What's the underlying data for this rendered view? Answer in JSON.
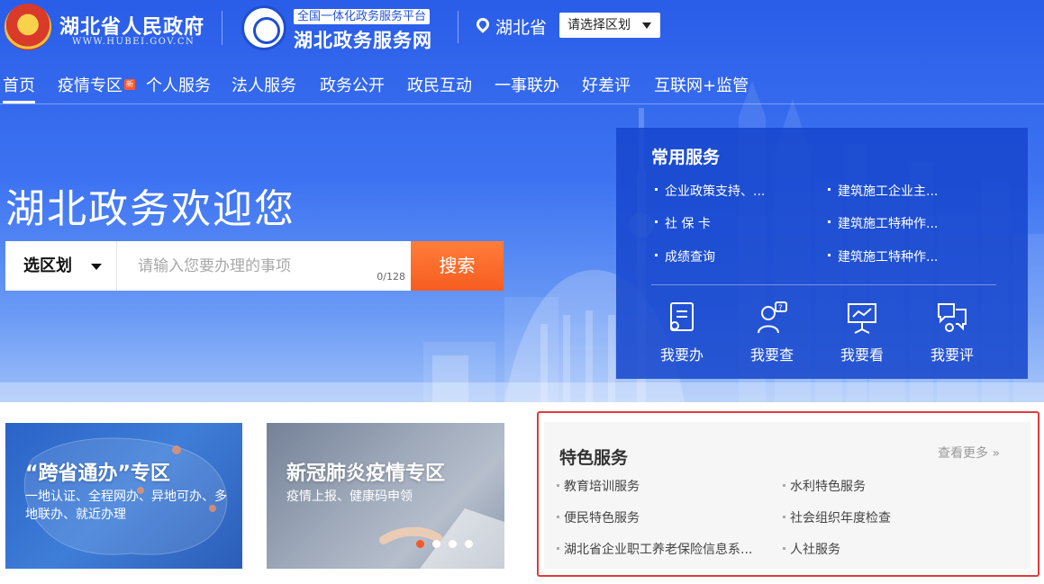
{
  "header": {
    "gov_name": "湖北省人民政府",
    "gov_url": "WWW.HUBEI.GOV.CN",
    "platform_sub": "全国一体化政务服务平台",
    "platform_name": "湖北政务服务网",
    "location": "湖北省",
    "region_select_label": "请选择区划"
  },
  "nav": {
    "items": [
      {
        "label": "首页",
        "active": true
      },
      {
        "label": "疫情专区",
        "badge": "新"
      },
      {
        "label": "个人服务"
      },
      {
        "label": "法人服务"
      },
      {
        "label": "政务公开"
      },
      {
        "label": "政民互动"
      },
      {
        "label": "一事联办"
      },
      {
        "label": "好差评"
      },
      {
        "label": "互联网+监管"
      }
    ]
  },
  "hero": {
    "welcome": "湖北政务欢迎您",
    "search_region_label": "选区划",
    "search_placeholder": "请输入您要办理的事项",
    "search_count": "0/128",
    "search_button": "搜索"
  },
  "common_services": {
    "title": "常用服务",
    "links": [
      "企业政策支持、...",
      "建筑施工企业主...",
      "社 保 卡",
      "建筑施工特种作...",
      "成绩查询",
      "建筑施工特种作..."
    ],
    "actions": [
      {
        "label": "我要办",
        "icon": "handle-icon"
      },
      {
        "label": "我要查",
        "icon": "inquiry-icon"
      },
      {
        "label": "我要看",
        "icon": "presentation-icon"
      },
      {
        "label": "我要评",
        "icon": "review-icon"
      }
    ]
  },
  "cards": {
    "kuasheng": {
      "title": "“跨省通办”专区",
      "desc": "一地认证、全程网办、异地可办、多地联办、就近办理"
    },
    "yiqing": {
      "title": "新冠肺炎疫情专区",
      "desc": "疫情上报、健康码申领"
    }
  },
  "featured_services": {
    "title": "特色服务",
    "more": "查看更多 »",
    "links": [
      "教育培训服务",
      "水利特色服务",
      "便民特色服务",
      "社会组织年度检查",
      "湖北省企业职工养老保险信息系...",
      "人社服务"
    ]
  },
  "colors": {
    "brand_blue": "#2a5de8",
    "search_orange": "#f75d20",
    "highlight_red": "#e03a3a"
  }
}
